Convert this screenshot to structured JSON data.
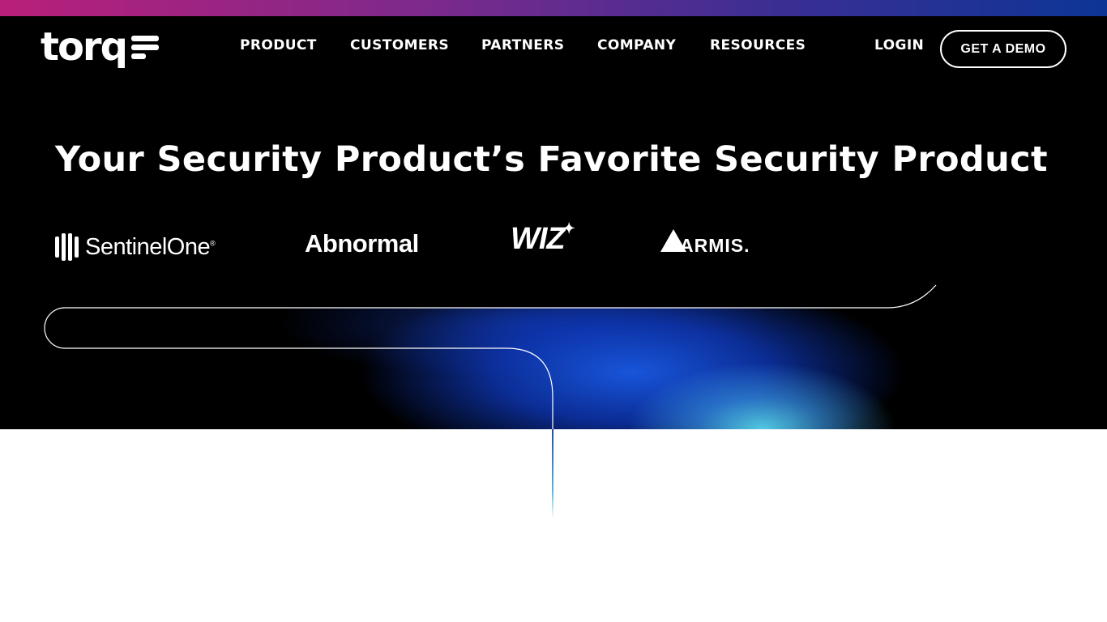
{
  "brand": {
    "logo_text": "torq",
    "logo_icon": "torq-stripes-icon"
  },
  "nav": {
    "items": [
      {
        "label": "PRODUCT"
      },
      {
        "label": "CUSTOMERS"
      },
      {
        "label": "PARTNERS"
      },
      {
        "label": "COMPANY"
      },
      {
        "label": "RESOURCES"
      }
    ],
    "login_label": "LOGIN",
    "demo_label": "GET A DEMO"
  },
  "hero": {
    "headline": "Your Security Product’s Favorite Security Product"
  },
  "logos": {
    "sentinelone": "SentinelOne",
    "sentinelone_mark": "®",
    "abnormal": "Abnormal",
    "wiz": "WIZ",
    "wiz_star": "✦",
    "armis": "ARMIS."
  },
  "colors": {
    "stripe_start": "#b91f7a",
    "stripe_end": "#0d3596",
    "hero_bg": "#000000",
    "glow_blue": "#1a5ae6",
    "glow_cyan": "#56d2eb"
  }
}
